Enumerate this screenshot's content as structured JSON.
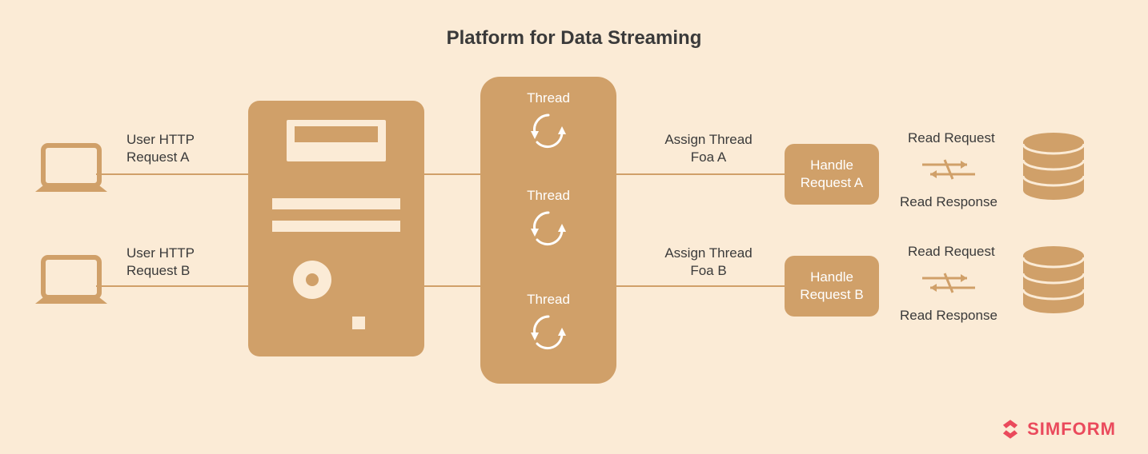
{
  "title": "Platform for Data Streaming",
  "users": {
    "requestA": "User HTTP\nRequest A",
    "requestB": "User HTTP\nRequest B"
  },
  "threads": {
    "t1": "Thread",
    "t2": "Thread",
    "t3": "Thread"
  },
  "assign": {
    "a": "Assign Thread\nFoa A",
    "b": "Assign Thread\nFoa B"
  },
  "handle": {
    "a": "Handle\nRequest A",
    "b": "Handle\nRequest B"
  },
  "db": {
    "readReqA": "Read Request",
    "readRespA": "Read Response",
    "readReqB": "Read Request",
    "readRespB": "Read Response"
  },
  "brand": "SIMFORM",
  "colors": {
    "bg": "#fbebd6",
    "fill": "#d0a069",
    "text": "#3a3a3a",
    "white": "#ffffff",
    "brand": "#ea4a5c"
  }
}
